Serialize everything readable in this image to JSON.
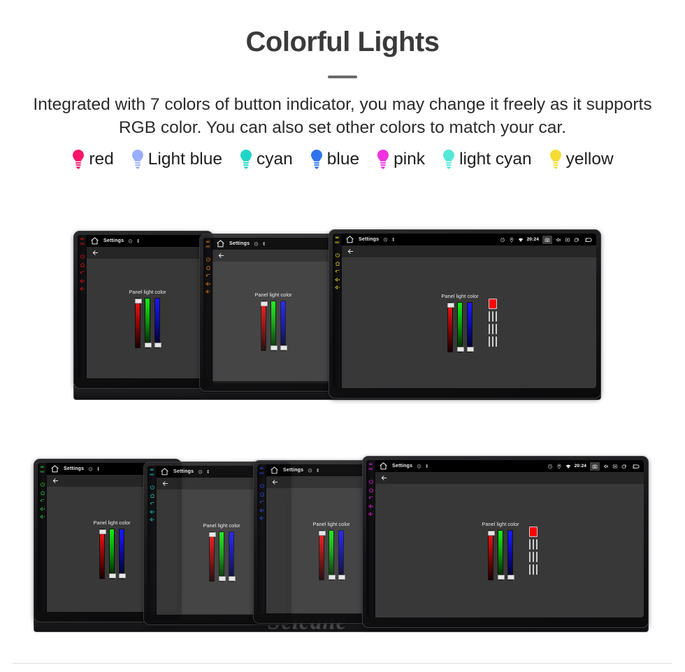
{
  "header": {
    "title": "Colorful Lights",
    "subtitle": "Integrated with 7 colors of button indicator, you may change it freely as it supports RGB color. You can also set other colors to match your car."
  },
  "legend": {
    "items": [
      {
        "label": "red",
        "color": "#f6156a",
        "icon": "bulb-icon"
      },
      {
        "label": "Light blue",
        "color": "#9aaeff",
        "icon": "bulb-icon"
      },
      {
        "label": "cyan",
        "color": "#1ed6c8",
        "icon": "bulb-icon"
      },
      {
        "label": "blue",
        "color": "#2f74ef",
        "icon": "bulb-icon"
      },
      {
        "label": "pink",
        "color": "#ef31e0",
        "icon": "bulb-icon"
      },
      {
        "label": "light cyan",
        "color": "#55e8d6",
        "icon": "bulb-icon"
      },
      {
        "label": "yellow",
        "color": "#f3dd34",
        "icon": "bulb-icon"
      }
    ]
  },
  "device_ui": {
    "statusbar": {
      "home_icon": "home-icon",
      "title": "Settings",
      "clock_icon": "clock-icon",
      "bluetooth_icon": "bluetooth-icon",
      "alarm_icon": "alarm-icon",
      "location_icon": "location-icon",
      "wifi_icon": "wifi-icon",
      "time": "20:24",
      "camera_icon": "camera-icon",
      "volume_icon": "volume-icon",
      "close_icon": "close-box-icon",
      "recents_icon": "recents-icon",
      "back_icon": "back-arrow-icon"
    },
    "actionbar": {
      "back_icon": "back-arrow-icon"
    },
    "panel": {
      "label": "Panel light color",
      "sliders": [
        {
          "name": "red-slider",
          "channel": "R",
          "thumb": "top"
        },
        {
          "name": "green-slider",
          "channel": "G",
          "thumb": "bottom"
        },
        {
          "name": "blue-slider",
          "channel": "B",
          "thumb": "bottom"
        }
      ]
    },
    "palette": {
      "preview": "#ff0000",
      "rows": [
        [
          "#ff0000",
          "#00e800",
          "#0c0cdc"
        ],
        [
          "#fc8383",
          "#90f090",
          "#8e90f6"
        ],
        [
          "#fcf000",
          "#ffffff",
          "rainbow"
        ]
      ]
    },
    "rail": {
      "mic_label": "MIC",
      "rst_label": "RST",
      "icons": [
        "power-icon",
        "home-icon",
        "back-icon",
        "volume-up-icon",
        "volume-down-icon"
      ]
    }
  },
  "groups": {
    "top": {
      "devices": [
        {
          "name": "device-red",
          "rail_color": "#e11313",
          "has_palette": false,
          "has_full_statusbar": false
        },
        {
          "name": "device-orange",
          "rail_color": "#e8801a",
          "has_palette": false,
          "has_full_statusbar": false
        },
        {
          "name": "device-yellow",
          "rail_color": "#e8d41c",
          "has_palette": true,
          "has_full_statusbar": true
        }
      ]
    },
    "bottom": {
      "devices": [
        {
          "name": "device-green",
          "rail_color": "#20c42a",
          "has_palette": false,
          "has_full_statusbar": false
        },
        {
          "name": "device-cyan",
          "rail_color": "#19ccc0",
          "has_palette": false,
          "has_full_statusbar": false
        },
        {
          "name": "device-blue",
          "rail_color": "#2a4ef0",
          "has_palette": false,
          "has_full_statusbar": false
        },
        {
          "name": "device-magenta",
          "rail_color": "#e81ce0",
          "has_palette": true,
          "has_full_statusbar": true
        }
      ]
    }
  },
  "watermark": {
    "text": "Seicane"
  }
}
